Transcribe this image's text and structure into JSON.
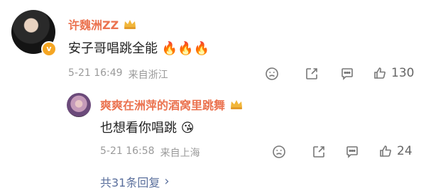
{
  "comment": {
    "username": "许魏洲ZZ",
    "text": "安子哥唱跳全能",
    "emoji": "🔥🔥🔥",
    "date": "5-21 16:49",
    "location": "来自浙江",
    "like_count": "130",
    "colors": {
      "username": "#eb7350",
      "verified": "#f5a623"
    }
  },
  "reply": {
    "username": "爽爽在洲萍的酒窝里跳舞",
    "text": "也想看你唱跳",
    "emoji": "😘",
    "date": "5-21 16:58",
    "location": "来自上海",
    "like_count": "24"
  },
  "replies_summary": {
    "text": "共31条回复",
    "chevron": "›"
  },
  "icons": [
    "verified-icon",
    "crown-badge-icon",
    "dislike-icon",
    "share-icon",
    "comment-icon",
    "like-icon",
    "chevron-right-icon"
  ]
}
